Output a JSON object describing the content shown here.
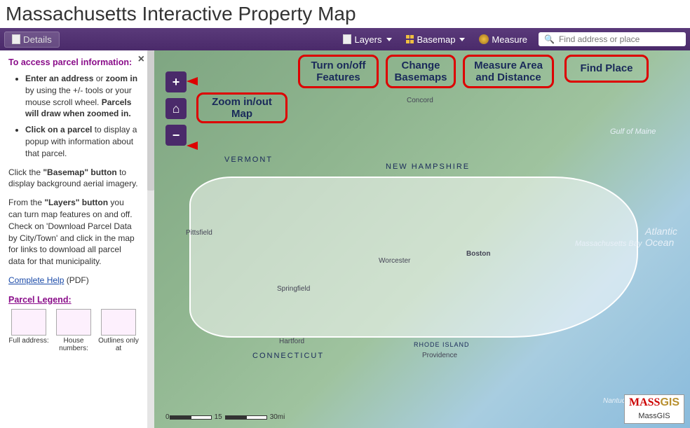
{
  "page_title": "Massachusetts Interactive Property Map",
  "toolbar": {
    "details_label": "Details",
    "layers_label": "Layers",
    "basemap_label": "Basemap",
    "measure_label": "Measure",
    "search_placeholder": "Find address or place"
  },
  "sidebar": {
    "heading": "To access parcel information:",
    "bullets": [
      {
        "pre": "Enter an address",
        "mid": " or ",
        "b2": "zoom in",
        "post": " by using the +/- tools or your mouse scroll wheel. ",
        "b3": "Parcels will draw when zoomed in."
      },
      {
        "pre": "Click on a parcel",
        "post": " to display a popup with information about that parcel."
      }
    ],
    "para1_a": "Click the ",
    "para1_b": "\"Basemap\" button",
    "para1_c": " to display background aerial imagery.",
    "para2_a": "From the ",
    "para2_b": "\"Layers\" button",
    "para2_c": " you can turn map features on and off. Check on 'Download Parcel Data by City/Town' and click in the map for links to download all parcel data for that municipality.",
    "help_link": "Complete Help",
    "help_suffix": " (PDF)",
    "legend_title": "Parcel Legend:",
    "legend_items": [
      "Full address:",
      "House numbers:",
      "Outlines only at"
    ]
  },
  "callouts": {
    "zoom": "Zoom in/out Map",
    "layers": "Turn on/off Features",
    "basemap": "Change Basemaps",
    "measure": "Measure Area and Distance",
    "find": "Find Place"
  },
  "map_labels": {
    "vermont": "VERMONT",
    "new_hampshire": "NEW HAMPSHIRE",
    "connecticut": "CONNECTICUT",
    "rhode_island": "RHODE ISLAND",
    "gulf": "Gulf of Maine",
    "massbay": "Massachusetts Bay",
    "atlantic": "Atlantic Ocean",
    "nantucket": "Nantucket"
  },
  "cities": {
    "concord": "Concord",
    "pittsfield": "Pittsfield",
    "springfield": "Springfield",
    "worcester": "Worcester",
    "boston": "Boston",
    "hartford": "Hartford",
    "providence": "Providence"
  },
  "scale": {
    "t0": "0",
    "t1": "15",
    "t2": "30mi"
  },
  "logo": {
    "mass": "MASS",
    "gis": "GIS",
    "sub": "MassGIS"
  }
}
